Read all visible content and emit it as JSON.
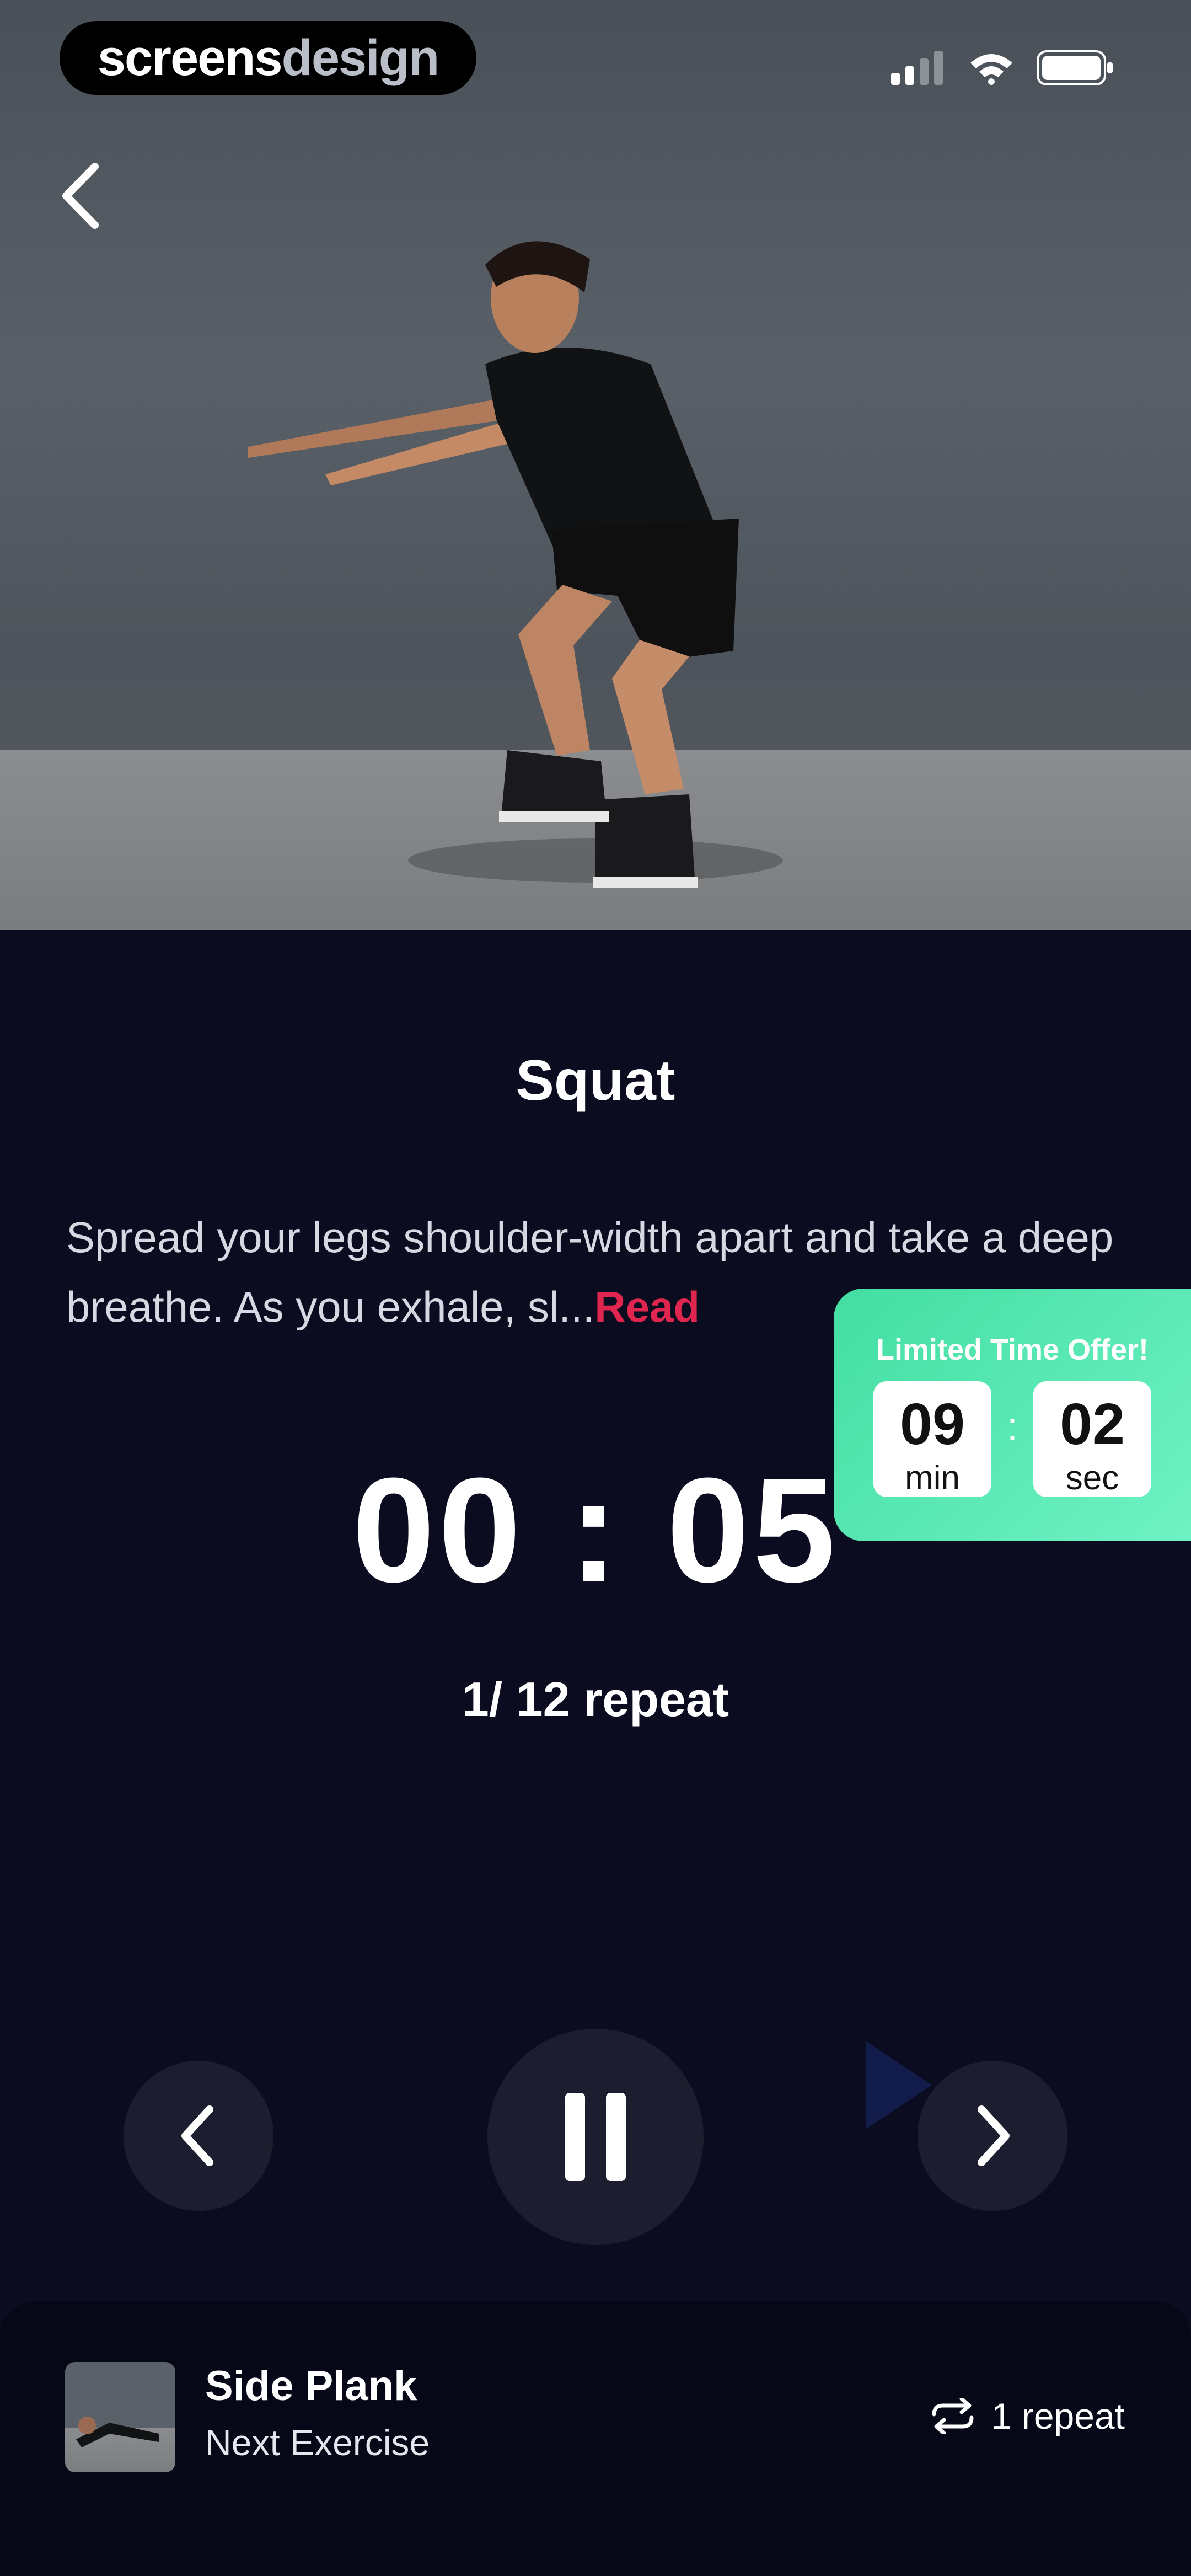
{
  "brand": {
    "logo_part1": "screens",
    "logo_part2": "design"
  },
  "status_bar": {
    "icons": [
      "signal-icon",
      "wifi-icon",
      "battery-icon"
    ]
  },
  "nav": {
    "back_icon": "chevron-left-icon"
  },
  "exercise": {
    "title": "Squat",
    "description": "Spread your legs shoulder-width apart and take a deep breathe. As you exhale, sl...",
    "read_more": "Read"
  },
  "timer": {
    "display": "00 : 05"
  },
  "progress": {
    "repeat_text": "1/ 12  repeat"
  },
  "offer": {
    "title": "Limited Time Offer!",
    "minutes": "09",
    "minutes_unit": "min",
    "separator": ":",
    "seconds": "02",
    "seconds_unit": "sec"
  },
  "controls": {
    "prev_icon": "chevron-left-icon",
    "pause_icon": "pause-icon",
    "next_icon": "chevron-right-icon"
  },
  "next_exercise": {
    "name": "Side Plank",
    "label": "Next Exercise",
    "repeat_text": "1 repeat",
    "repeat_icon": "repeat-icon"
  },
  "colors": {
    "background": "#0b0c1f",
    "accent_read": "#e0264f",
    "offer_green": "#43dea3",
    "control_bg": "#1c1d2e"
  }
}
